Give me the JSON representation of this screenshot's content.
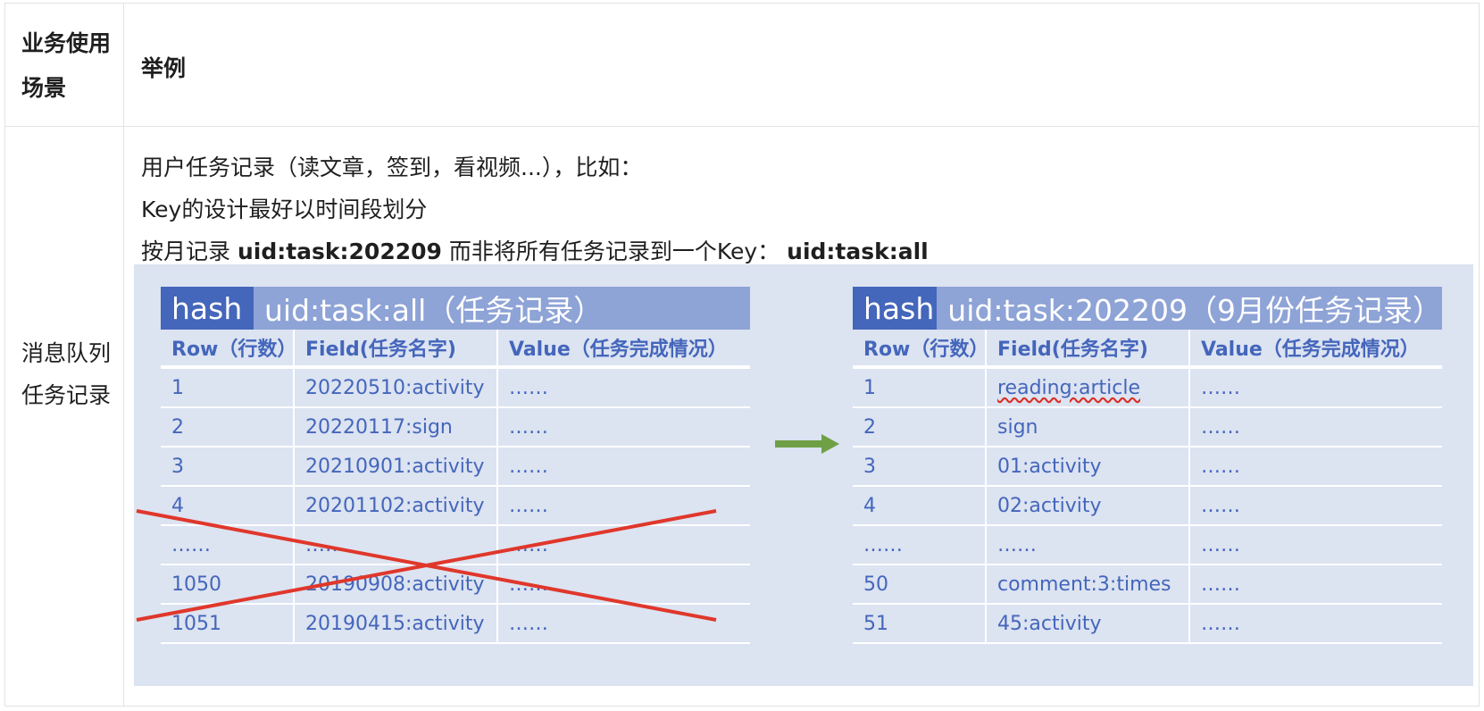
{
  "header": {
    "scene": "业务使用场景",
    "example": "举例"
  },
  "row": {
    "scene": "消息队列任务记录",
    "lines": {
      "l1": "用户任务记录（读文章，签到，看视频...），比如：",
      "l2": "Key的设计最好以时间段划分",
      "l3_prefix": "按月记录 ",
      "l3_bold1": "uid:task:202209",
      "l3_mid": " 而非将所有任务记录到一个Key：  ",
      "l3_bold2": "uid:task:all"
    }
  },
  "left_table": {
    "tag": "hash",
    "name": "uid:task:all（任务记录）",
    "columns": [
      "Row（行数）",
      "Field(任务名字)",
      "Value（任务完成情况）"
    ],
    "rows": [
      [
        "1",
        "20220510:activity",
        "……"
      ],
      [
        "2",
        "20220117:sign",
        "……"
      ],
      [
        "3",
        "20210901:activity",
        "……"
      ],
      [
        "4",
        "20201102:activity",
        "……"
      ],
      [
        "……",
        "……",
        "……"
      ],
      [
        "1050",
        "20190908:activity",
        "……"
      ],
      [
        "1051",
        "20190415:activity",
        "……"
      ]
    ]
  },
  "right_table": {
    "tag": "hash",
    "name": "uid:task:202209（9月份任务记录）",
    "columns": [
      "Row（行数）",
      "Field(任务名字)",
      "Value（任务完成情况）"
    ],
    "rows": [
      [
        "1",
        "reading:article",
        "……"
      ],
      [
        "2",
        "sign",
        "……"
      ],
      [
        "3",
        "01:activity",
        "……"
      ],
      [
        "4",
        "02:activity",
        "……"
      ],
      [
        "……",
        "……",
        "……"
      ],
      [
        "50",
        "comment:3:times",
        "……"
      ],
      [
        "51",
        "45:activity",
        "……"
      ]
    ]
  },
  "colors": {
    "accent": "#4466bb",
    "title_bg": "#8ea3d6",
    "panel_bg": "#dce3f1",
    "arrow": "#6fa046",
    "cross": "#e0372b"
  }
}
